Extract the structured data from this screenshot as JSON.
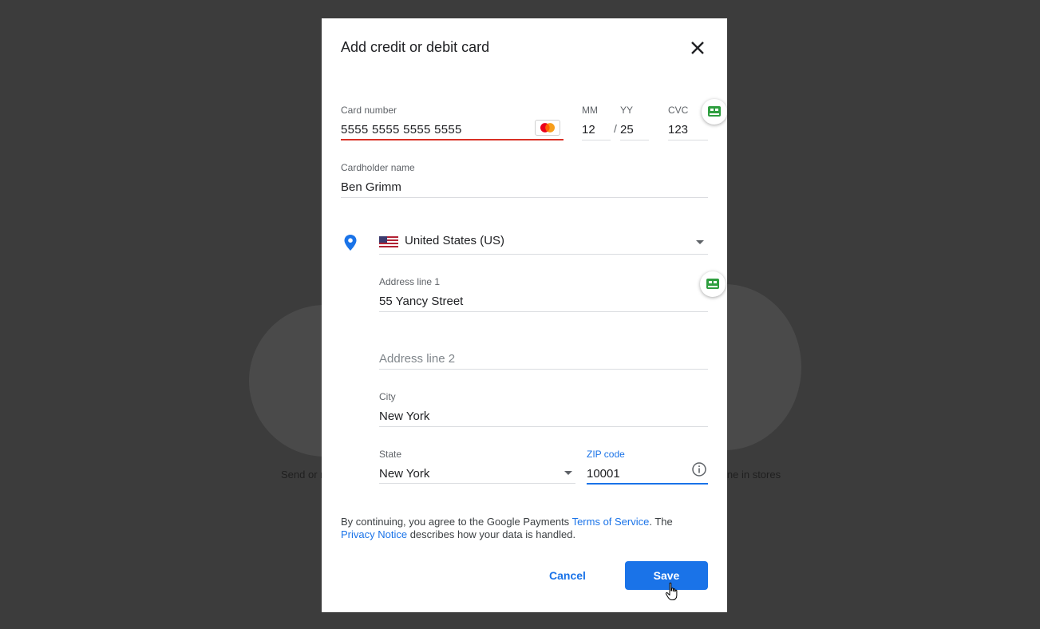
{
  "background": {
    "left_caption": "Send or r",
    "right_caption": "ine in stores"
  },
  "dialog": {
    "title": "Add credit or debit card",
    "close_icon": "close-icon"
  },
  "card": {
    "number_label": "Card number",
    "number_value": "5555  5555  5555  5555",
    "brand_icon": "mastercard-icon",
    "mm_label": "MM",
    "mm_value": "12",
    "separator": "/",
    "yy_label": "YY",
    "yy_value": "25",
    "cvc_label": "CVC",
    "cvc_value": "123"
  },
  "cardholder": {
    "label": "Cardholder name",
    "value": "Ben Grimm"
  },
  "address": {
    "country_value": "United States (US)",
    "line1_label": "Address line 1",
    "line1_value": "55 Yancy Street",
    "line2_placeholder": "Address line 2",
    "city_label": "City",
    "city_value": "New York",
    "state_label": "State",
    "state_value": "New York",
    "zip_label": "ZIP code",
    "zip_value": "10001"
  },
  "legal": {
    "text_1": "By continuing, you agree to the Google Payments ",
    "terms_link": "Terms of Service",
    "text_2": ". The ",
    "privacy_link": "Privacy Notice",
    "text_3": " describes how your data is handled."
  },
  "actions": {
    "cancel_label": "Cancel",
    "save_label": "Save"
  },
  "colors": {
    "accent": "#1a73e8",
    "error": "#d93025",
    "extension_green": "#34a853"
  }
}
